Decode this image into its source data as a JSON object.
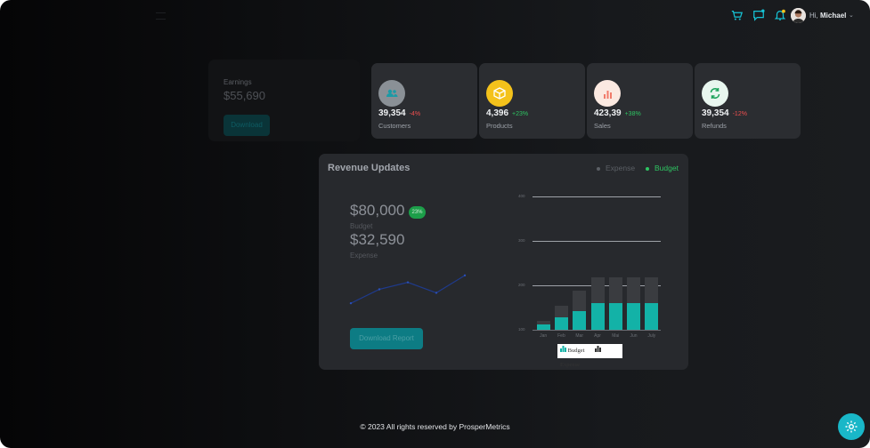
{
  "header": {
    "greeting": "Hi,",
    "user": "Michael"
  },
  "icons": {
    "cart": "cart-icon",
    "chat": "chat-icon",
    "bell": "bell-icon",
    "chevron": "chevron-down-icon",
    "settings": "gear-icon"
  },
  "earnings": {
    "label": "Earnings",
    "value": "$55,690",
    "button": "Download"
  },
  "stats": [
    {
      "value": "39,354",
      "change": "-4%",
      "label": "Customers",
      "icon": "users-icon"
    },
    {
      "value": "4,396",
      "change": "+23%",
      "label": "Products",
      "icon": "box-icon"
    },
    {
      "value": "423,39",
      "change": "+38%",
      "label": "Sales",
      "icon": "bar-chart-icon"
    },
    {
      "value": "39,354",
      "change": "-12%",
      "label": "Refunds",
      "icon": "refresh-icon"
    }
  ],
  "revenue": {
    "title": "Revenue Updates",
    "legend_expense": "Expense",
    "legend_budget": "Budget",
    "budget_value": "$80,000",
    "budget_badge": "23%",
    "budget_label": "Budget",
    "expense_value": "$32,590",
    "expense_label": "Expense",
    "download_button": "Download Report"
  },
  "chart_data": [
    {
      "type": "line",
      "x": [
        1,
        2,
        3,
        4,
        5
      ],
      "values": [
        2,
        6,
        8,
        5,
        10
      ],
      "ylim": [
        0,
        12
      ]
    },
    {
      "type": "bar",
      "stacked": true,
      "categories": [
        "Jan",
        "Feb",
        "Mar",
        "Apr",
        "Mai",
        "Jun",
        "July"
      ],
      "series": [
        {
          "name": "Budget",
          "values": [
            112,
            128,
            143,
            160,
            160,
            160,
            160
          ]
        },
        {
          "name": "Expense",
          "values": [
            120,
            155,
            188,
            218,
            218,
            218,
            218
          ]
        }
      ],
      "yticks": [
        "100",
        "200",
        "300",
        "400"
      ],
      "ylim": [
        100,
        400
      ],
      "legend_labels": [
        "Budget",
        "Expense"
      ]
    }
  ],
  "footer": "© 2023 All rights reserved by ProsperMetrics"
}
